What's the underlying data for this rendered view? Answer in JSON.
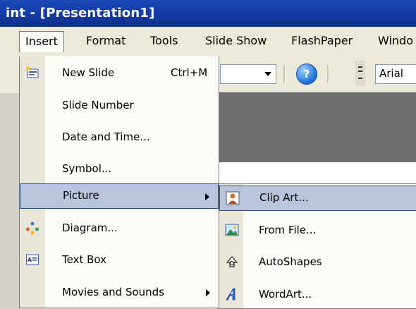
{
  "window": {
    "title": "int - [Presentation1]"
  },
  "menubar": {
    "items": [
      {
        "label": "Insert",
        "active": true
      },
      {
        "label": "Format"
      },
      {
        "label": "Tools"
      },
      {
        "label": "Slide Show"
      },
      {
        "label": "FlashPaper"
      },
      {
        "label": "Windo"
      }
    ]
  },
  "toolbar": {
    "font_name": "Arial",
    "help_label": "?"
  },
  "insert_menu": {
    "items": [
      {
        "label": "New Slide",
        "shortcut": "Ctrl+M",
        "icon": "new-slide-icon"
      },
      {
        "label": "Slide Number"
      },
      {
        "label": "Date and Time..."
      },
      {
        "label": "Symbol..."
      },
      {
        "label": "Picture",
        "submenu": true,
        "highlighted": true
      },
      {
        "label": "Diagram...",
        "icon": "diagram-icon"
      },
      {
        "label": "Text Box",
        "icon": "text-box-icon"
      },
      {
        "label": "Movies and Sounds",
        "submenu": true
      }
    ]
  },
  "picture_menu": {
    "items": [
      {
        "label": "Clip Art...",
        "icon": "clip-art-icon",
        "highlighted": true
      },
      {
        "label": "From File...",
        "icon": "from-file-icon"
      },
      {
        "label": "AutoShapes",
        "icon": "autoshapes-icon"
      },
      {
        "label": "WordArt...",
        "icon": "wordart-icon"
      }
    ]
  },
  "colors": {
    "titlebar": "#123aa2",
    "menu_bg": "#ece9d8",
    "highlight": "#b8c5dd",
    "highlight_border": "#2b4b8a"
  }
}
